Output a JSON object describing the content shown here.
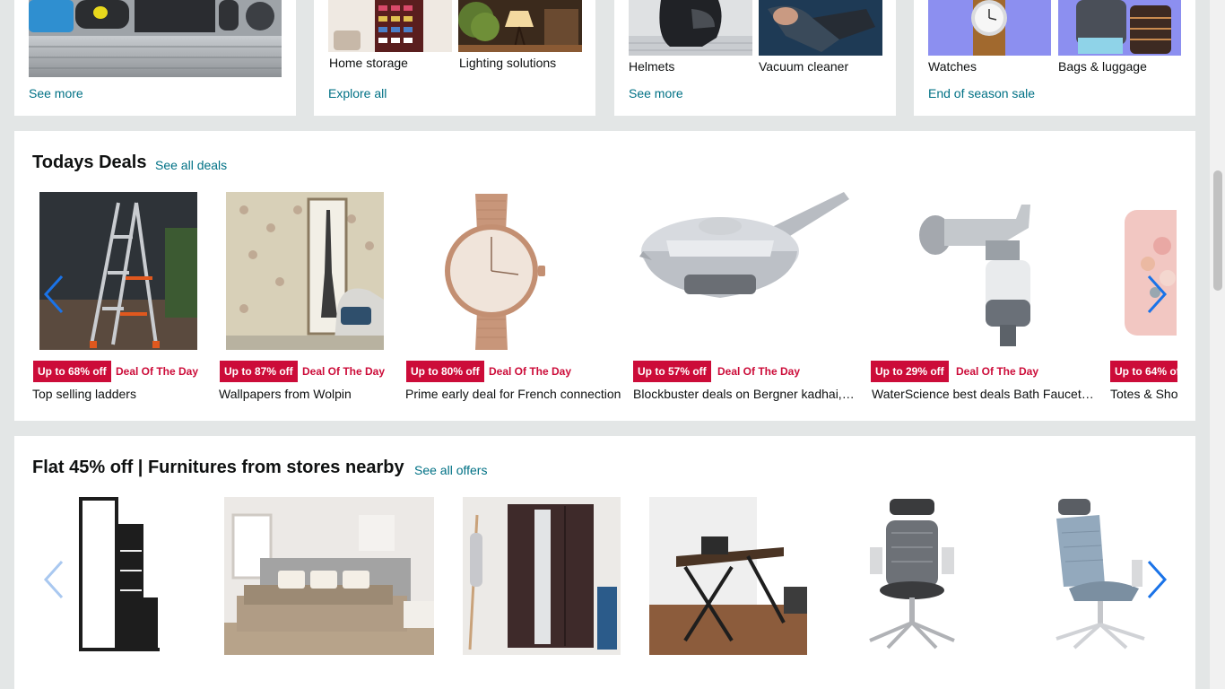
{
  "top_cards": [
    {
      "link": "See more",
      "tiles": []
    },
    {
      "link": "Explore all",
      "tiles": [
        "Home storage",
        "Lighting solutions"
      ]
    },
    {
      "link": "See more",
      "tiles": [
        "Helmets",
        "Vacuum cleaner"
      ]
    },
    {
      "link": "End of season sale",
      "tiles": [
        "Watches",
        "Bags & luggage"
      ]
    }
  ],
  "todays_deals": {
    "title": "Todays Deals",
    "see_all": "See all deals",
    "deal_label": "Deal Of The Day",
    "items": [
      {
        "badge": "Up to 68% off",
        "title": "Top selling ladders"
      },
      {
        "badge": "Up to 87% off",
        "title": "Wallpapers from Wolpin"
      },
      {
        "badge": "Up to 80% off",
        "title": "Prime early deal for French connection"
      },
      {
        "badge": "Up to 57% off",
        "title": "Blockbuster deals on Bergner kadhai, t..."
      },
      {
        "badge": "Up to 29% off",
        "title": "WaterScience best deals Bath Faucets ..."
      },
      {
        "badge": "Up to 64% of",
        "title": "Totes & Sho"
      }
    ]
  },
  "furniture": {
    "title": "Flat 45% off | Furnitures from stores nearby",
    "see_all": "See all offers"
  },
  "colors": {
    "link": "#007185",
    "deal_red": "#cc0c39",
    "arrow_blue": "#1a73e8"
  }
}
